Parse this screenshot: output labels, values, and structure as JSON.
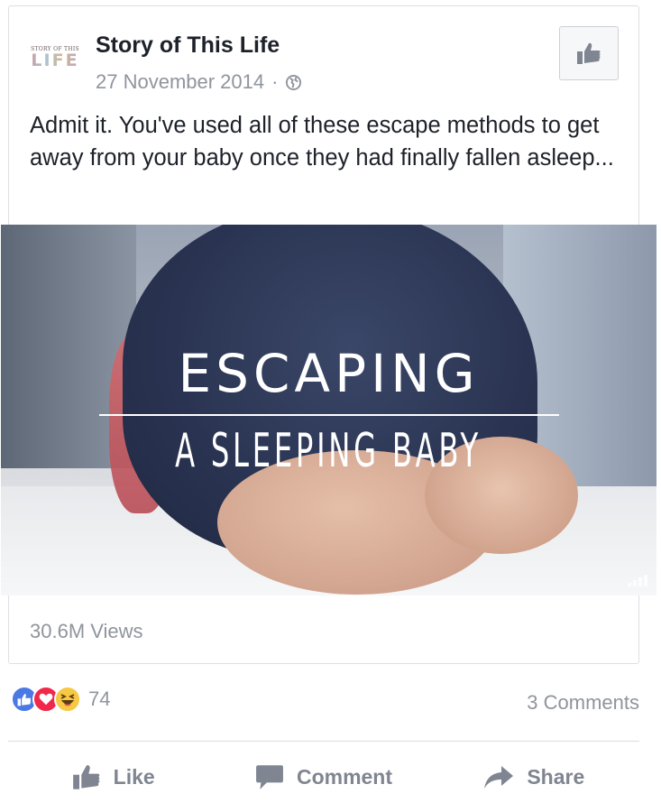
{
  "post": {
    "page_name": "Story of This Life",
    "avatar_small_text": "STORY OF THIS",
    "avatar_big_text": "LIFE",
    "date": "27 November 2014",
    "separator": "·",
    "text": "Admit it. You've used all of these escape methods to get away from your baby once they had finally fallen asleep..."
  },
  "video": {
    "title_line1": "ESCAPING",
    "title_line2": "A SLEEPING BABY",
    "views": "30.6M Views"
  },
  "reactions": {
    "icons": [
      "like-icon",
      "love-icon",
      "haha-icon"
    ],
    "count": "74",
    "comments": "3 Comments"
  },
  "actions": {
    "like": "Like",
    "comment": "Comment",
    "share": "Share"
  },
  "colors": {
    "like_reaction": "#4a79e6",
    "love_reaction": "#f0284a",
    "haha_reaction": "#f7c844",
    "muted_text": "#90949c",
    "action_text": "#7f8591"
  }
}
